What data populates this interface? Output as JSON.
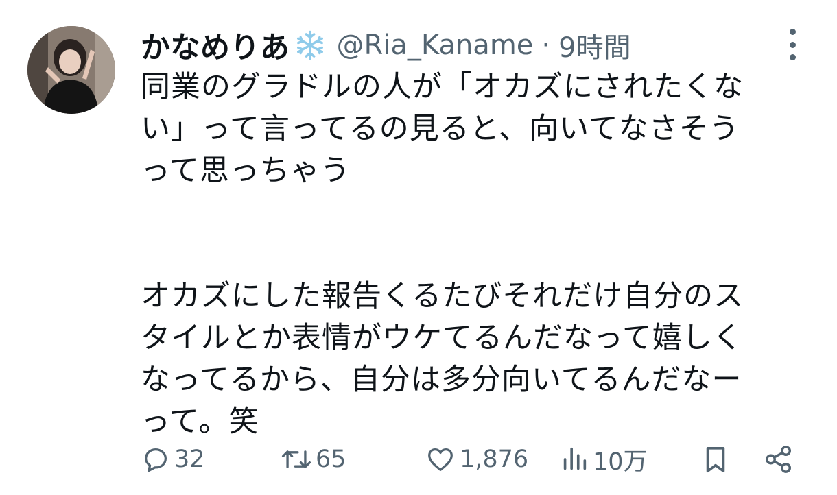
{
  "tweet": {
    "display_name": "かなめりあ",
    "handle": "@Ria_Kaname",
    "separator": "·",
    "time": "9時間",
    "body": {
      "lines_para1": [
        "同業のグラドルの人が「オカズにされたくな",
        "い」って言ってるの見ると、向いてなさそう",
        "って思っちゃう"
      ],
      "lines_para2": [
        "オカズにした報告くるたびそれだけ自分のス",
        "タイルとか表情がウケてるんだなって嬉しく",
        "なってるから、自分は多分向いてるんだなー",
        "って。笑"
      ]
    }
  },
  "actions": {
    "replies": "32",
    "retweets": "65",
    "likes": "1,876",
    "views": "10万"
  },
  "icons": {
    "name_badge": "snowflake-icon",
    "more": "more-vertical-icon",
    "reply": "reply-icon",
    "retweet": "retweet-icon",
    "like": "heart-icon",
    "views": "views-icon",
    "bookmark": "bookmark-icon",
    "share": "share-icon"
  },
  "colors": {
    "text": "#0f1419",
    "secondary": "#536471",
    "snowflake": "#8fcbea"
  }
}
